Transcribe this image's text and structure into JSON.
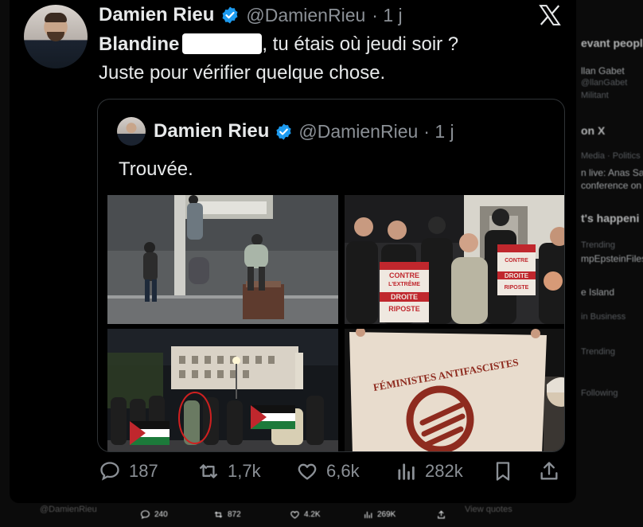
{
  "background": {
    "sidebar_lines": [
      {
        "text": "evant people",
        "style": "bold"
      },
      {
        "text": "llan Gabet",
        "style": "normal"
      },
      {
        "text": "@llanGabet",
        "style": "dim"
      },
      {
        "text": "Militant",
        "style": "dim"
      },
      {
        "text": "on X",
        "style": "bold"
      },
      {
        "text": "Media · Politics",
        "style": "dim"
      },
      {
        "text": "n live: Anas Sarw",
        "style": "normal"
      },
      {
        "text": "conference on",
        "style": "normal"
      },
      {
        "text": "t's happeni",
        "style": "bold"
      },
      {
        "text": "Trending",
        "style": "dim"
      },
      {
        "text": "mpEpsteinFiles",
        "style": "normal"
      },
      {
        "text": "e Island",
        "style": "normal"
      },
      {
        "text": "in Business",
        "style": "dim"
      },
      {
        "text": "Trending",
        "style": "dim"
      },
      {
        "text": "Following",
        "style": "dim"
      }
    ],
    "footer": {
      "handle": "@DamienRieu",
      "replies": "240",
      "reposts": "872",
      "likes": "4.2K",
      "views": "269K",
      "right_text": "View quotes"
    }
  },
  "tweet": {
    "author_name": "Damien Rieu",
    "author_handle": "@DamienRieu",
    "time": "· 1 j",
    "line1_before": "Blandine",
    "line1_after": ", tu étais où jeudi soir ?",
    "line2": "Juste pour vérifier quelque chose.",
    "quote": {
      "author_name": "Damien Rieu",
      "author_handle": "@DamienRieu",
      "time": "· 1 j",
      "text": "Trouvée."
    },
    "photos": {
      "sign1": [
        "CONTRE",
        "L'EXTRÊME",
        "DROITE",
        "RIPOSTE"
      ],
      "banner": "FÉMINISTES ANTIFASCISTES"
    },
    "stats": {
      "replies": "187",
      "reposts": "1,7k",
      "likes": "6,6k",
      "views": "282k"
    }
  },
  "colors": {
    "background": "#000000",
    "text": "#e7e9ea",
    "secondary": "#8b9096",
    "verified": "#1d9bf0",
    "border": "#2f3336"
  }
}
